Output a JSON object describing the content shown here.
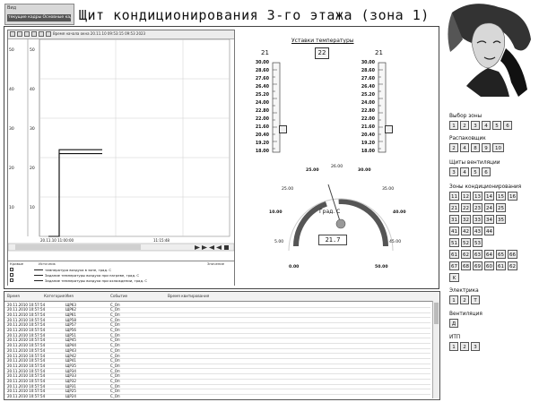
{
  "top_tab": {
    "label": "Вид",
    "subtitle": "текущие кадры Основные кадры 3"
  },
  "page_title": "Щит кондиционирования 3-го этажа (зона 1)",
  "trend": {
    "toolbar_caption": "Время начала окна 20.11.10 09:53:15 09:53 2023",
    "y_left_ticks": [
      "50",
      "40",
      "30",
      "20",
      "10"
    ],
    "y_right_ticks": [
      "50",
      "40",
      "30",
      "20",
      "10"
    ],
    "x_ticks": [
      "20.11.10 11:00:00",
      "11:15:48"
    ],
    "legend_headers": [
      "Кривые",
      "Источник",
      "Значение"
    ],
    "legend_items": [
      "температура воздуха в зоне, град. С",
      "Задание температуры воздуха при нагреве, град. С",
      "Задание температуры воздуха при охлаждении, град. С"
    ],
    "chart_data": {
      "type": "line",
      "ylim": [
        0,
        50
      ],
      "series": [
        {
          "values": [
            0,
            0,
            21,
            21,
            21
          ]
        },
        {
          "values": [
            0,
            0,
            22,
            22,
            22
          ]
        }
      ]
    }
  },
  "setpoints": {
    "title": "Уставки температуры",
    "left_value": "21",
    "center_value": "22",
    "right_value": "21",
    "scale_labels": [
      "30.00",
      "28.60",
      "27.60",
      "26.40",
      "25.20",
      "24.00",
      "22.80",
      "22.00",
      "21.60",
      "20.40",
      "19.20",
      "18.00"
    ]
  },
  "gauge": {
    "units": "Град. С",
    "value": "21.7",
    "labels": [
      "25.00",
      "26.00",
      "30.00",
      "25.00",
      "35.00",
      "10.00",
      "40.00",
      "5.00",
      "45.00",
      "0.00",
      "50.00"
    ]
  },
  "right_panel": {
    "zone_select": {
      "title": "Выбор зоны",
      "buttons": [
        "1",
        "2",
        "3",
        "4",
        "5",
        "6"
      ]
    },
    "distribution": {
      "title": "Распаковщик",
      "buttons": [
        "2",
        "4",
        "8",
        "9",
        "10"
      ]
    },
    "control_boards": {
      "title": "Щиты вентиляции",
      "buttons": [
        "3",
        "4",
        "5",
        "6"
      ]
    },
    "conditioning_zones": {
      "title": "Зоны кондиционирования",
      "rows": [
        [
          "11",
          "12",
          "13",
          "14",
          "15",
          "16"
        ],
        [
          "21",
          "22",
          "23",
          "24",
          "25"
        ],
        [
          "31",
          "32",
          "33",
          "34",
          "35"
        ],
        [
          "41",
          "42",
          "43",
          "44"
        ],
        [
          "51",
          "52",
          "53"
        ],
        [
          "61",
          "62",
          "63",
          "64",
          "65",
          "66"
        ],
        [
          "67",
          "68",
          "69",
          "60",
          "61",
          "62"
        ],
        [
          "K"
        ]
      ]
    },
    "power": {
      "title": "Электрика",
      "buttons": [
        "1",
        "2",
        "T"
      ]
    },
    "vent": {
      "title": "Вентиляция",
      "buttons": [
        "Д"
      ]
    },
    "itp": {
      "title": "ИТП",
      "buttons": [
        "1",
        "2",
        "3"
      ]
    }
  },
  "events": {
    "headers": [
      "Время",
      "Категория",
      "Имя",
      "Событие",
      "Время квитирования"
    ],
    "rows": [
      [
        "20.11.2010 10:57:54",
        "",
        "ЩР63",
        "С_Оп"
      ],
      [
        "20.11.2010 10:57:54",
        "",
        "ЩР62",
        "С_Оп"
      ],
      [
        "20.11.2010 10:57:54",
        "",
        "ЩР61",
        "С_Оп"
      ],
      [
        "20.11.2010 10:57:54",
        "",
        "ЩР58",
        "С_Оп"
      ],
      [
        "20.11.2010 10:57:54",
        "",
        "ЩР57",
        "С_Оп"
      ],
      [
        "20.11.2010 10:57:54",
        "",
        "ЩР56",
        "С_Оп"
      ],
      [
        "20.11.2010 10:57:54",
        "",
        "ЩР51",
        "С_Оп"
      ],
      [
        "20.11.2010 10:57:54",
        "",
        "ЩР45",
        "С_Оп"
      ],
      [
        "20.11.2010 10:57:54",
        "",
        "ЩР44",
        "С_Оп"
      ],
      [
        "20.11.2010 10:57:54",
        "",
        "ЩР43",
        "С_Оп"
      ],
      [
        "20.11.2010 10:57:54",
        "",
        "ЩР42",
        "С_Оп"
      ],
      [
        "20.11.2010 10:57:54",
        "",
        "ЩР41",
        "С_Оп"
      ],
      [
        "20.11.2010 10:57:54",
        "",
        "ЩР35",
        "С_Оп"
      ],
      [
        "20.11.2010 10:57:54",
        "",
        "ЩР34",
        "С_Оп"
      ],
      [
        "20.11.2010 10:57:54",
        "",
        "ЩР33",
        "С_Оп"
      ],
      [
        "20.11.2010 10:57:54",
        "",
        "ЩР32",
        "С_Оп"
      ],
      [
        "20.11.2010 10:57:54",
        "",
        "ЩР31",
        "С_Оп"
      ],
      [
        "20.11.2010 10:57:54",
        "",
        "ЩР25",
        "С_Оп"
      ],
      [
        "20.11.2010 10:57:54",
        "",
        "ЩР24",
        "С_Оп"
      ]
    ]
  },
  "colors": {
    "frame": "#444444",
    "panel_bg": "#ffffff",
    "button_bg": "#ececec",
    "gauge_arc": "#555555"
  }
}
